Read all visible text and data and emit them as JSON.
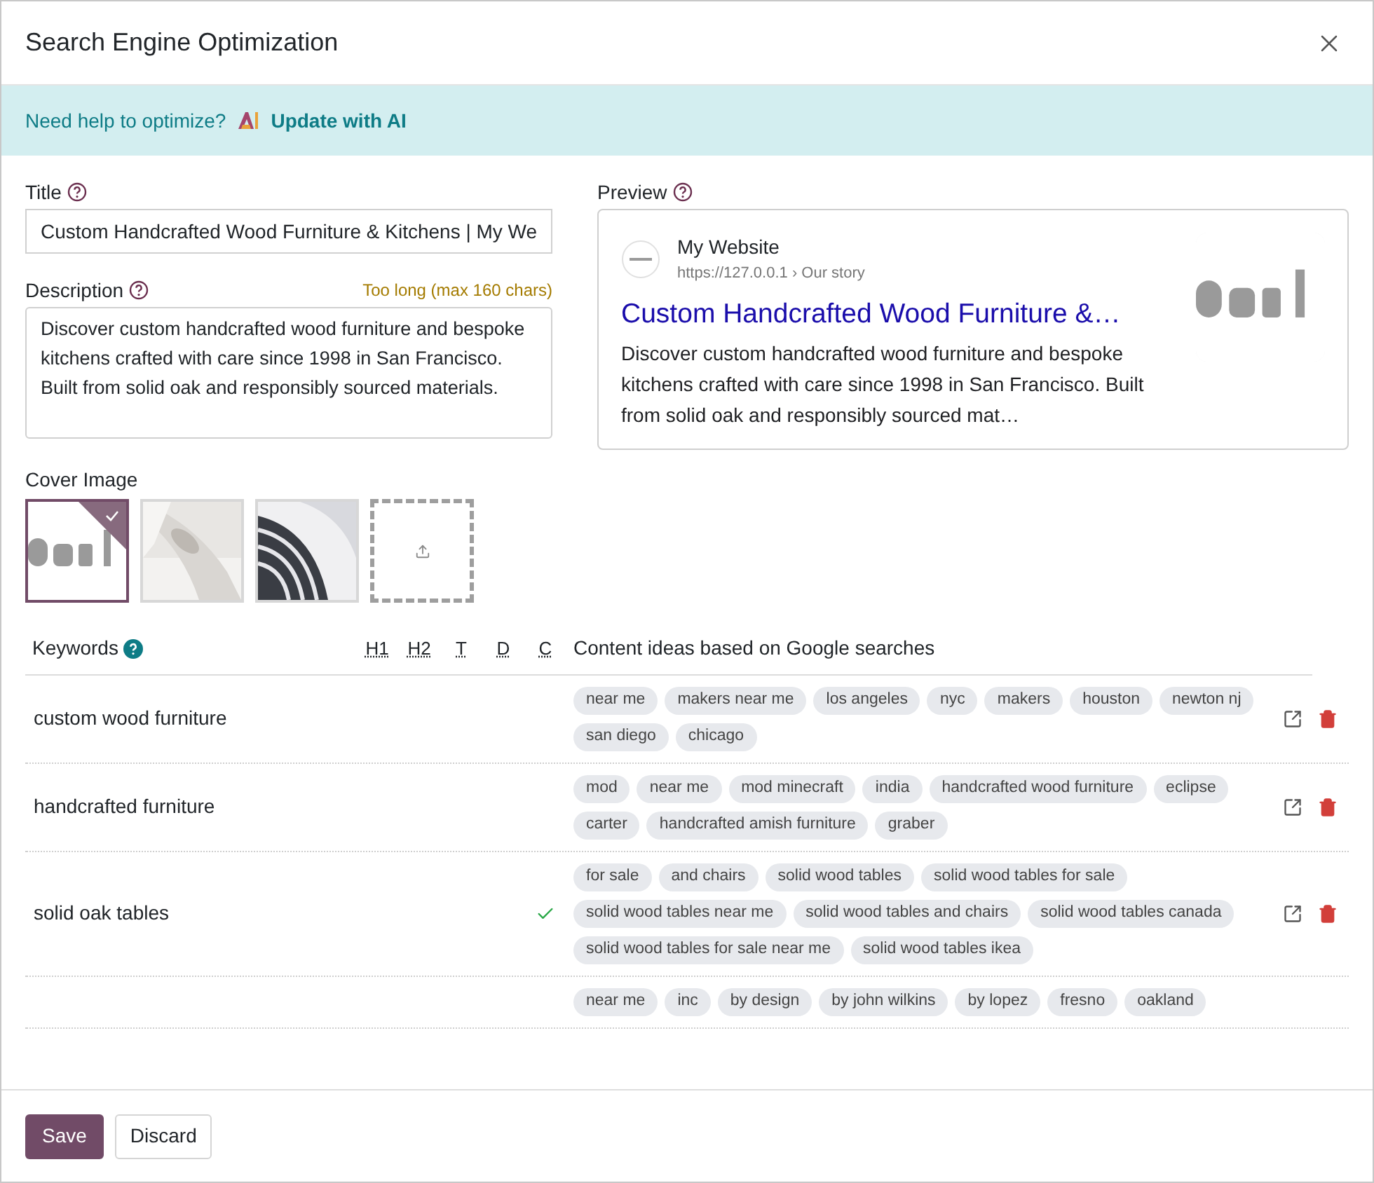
{
  "dialog": {
    "title": "Search Engine Optimization"
  },
  "banner": {
    "text": "Need help to optimize?",
    "action": "Update with AI"
  },
  "title_field": {
    "label": "Title",
    "value": "Custom Handcrafted Wood Furniture & Kitchens | My We"
  },
  "description_field": {
    "label": "Description",
    "warning": "Too long (max 160 chars)",
    "value": "Discover custom handcrafted wood furniture and bespoke kitchens crafted with care since 1998 in San Francisco. Built from solid oak and responsibly sourced materials."
  },
  "preview": {
    "label": "Preview",
    "site_name": "My Website",
    "url": "https://127.0.0.1 › Our story",
    "title": "Custom Handcrafted Wood Furniture &…",
    "description": "Discover custom handcrafted wood furniture and bespoke kitchens crafted with care since 1998 in San Francisco. Built from solid oak and responsibly sourced mat…"
  },
  "cover_image": {
    "label": "Cover Image",
    "images": [
      {
        "kind": "picture",
        "selected": true
      },
      {
        "kind": "picture",
        "selected": false
      },
      {
        "kind": "picture",
        "selected": false
      },
      {
        "kind": "upload",
        "selected": false
      }
    ]
  },
  "keywords": {
    "label": "Keywords",
    "columns": [
      "H1",
      "H2",
      "T",
      "D",
      "C"
    ],
    "ideas_heading": "Content ideas based on Google searches",
    "rows": [
      {
        "keyword": "custom wood furniture",
        "found": [
          false,
          false,
          false,
          false,
          false
        ],
        "ideas": [
          "near me",
          "makers near me",
          "los angeles",
          "nyc",
          "makers",
          "houston",
          "newton nj",
          "san diego",
          "chicago"
        ]
      },
      {
        "keyword": "handcrafted furniture",
        "found": [
          false,
          false,
          false,
          false,
          false
        ],
        "ideas": [
          "mod",
          "near me",
          "mod minecraft",
          "india",
          "handcrafted wood furniture",
          "eclipse",
          "carter",
          "handcrafted amish furniture",
          "graber"
        ]
      },
      {
        "keyword": "solid oak tables",
        "found": [
          false,
          false,
          false,
          false,
          true
        ],
        "ideas": [
          "for sale",
          "and chairs",
          "solid wood tables",
          "solid wood tables for sale",
          "solid wood tables near me",
          "solid wood tables and chairs",
          "solid wood tables canada",
          "solid wood tables for sale near me",
          "solid wood tables ikea"
        ]
      },
      {
        "ideas": [
          "near me",
          "inc",
          "by design",
          "by john wilkins",
          "by lopez",
          "fresno",
          "oakland"
        ]
      }
    ]
  },
  "footer": {
    "buttons": [
      "Save",
      "Discard"
    ]
  }
}
